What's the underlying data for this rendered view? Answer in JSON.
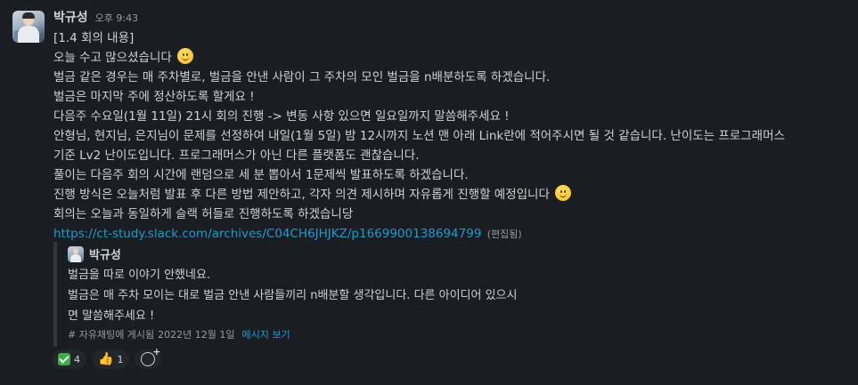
{
  "message": {
    "author": "박규성",
    "time": "오후 9:43",
    "lines": {
      "l1": "[1.4 회의 내용]",
      "l2": "오늘 수고 많으셨습니다",
      "l3": "벌금 같은 경우는 매 주차별로, 벌금을 안낸 사람이 그 주차의 모인 벌금을 n배분하도록 하겠습니다.",
      "l4": "벌금은 마지막 주에 정산하도록 할게요 !",
      "l5": "다음주 수요일(1월 11일) 21시 회의 진행 -> 변동 사항 있으면 일요일까지 말씀해주세요 !",
      "l6": "안형님, 현지님, 은지님이 문제를 선정하여 내일(1월 5일) 밤 12시까지 노션 맨 아래 Link란에 적어주시면 될 것 같습니다. 난이도는 프로그래머스",
      "l7": "기준 Lv2 난이도입니다. 프로그래머스가 아닌 다른 플랫폼도 괜찮습니다.",
      "l8": "풀이는 다음주 회의 시간에 랜덤으로 세 분 뽑아서 1문제씩 발표하도록 하겠습니다.",
      "l9": "진행 방식은 오늘처럼 발표 후 다른 방법 제안하고, 각자 의견 제시하며 자유롭게 진행할 예정입니다",
      "l10": "회의는 오늘과 동일하게 슬랙 허들로 진행하도록 하겠습니당"
    },
    "link": "https://ct-study.slack.com/archives/C04CH6JHJKZ/p1669900138694799",
    "edited": "(편집됨)",
    "emoji": "slightly-smiling-face"
  },
  "quote": {
    "author": "박규성",
    "lines": {
      "q1": "벌금을 따로 이야기 안했네요.",
      "q2": "벌금은 매 주차 모이는 대로 벌금 안낸 사람들끼리 n배분할 생각입니다. 다른 아이디어 있으시",
      "q3": "면 말씀해주세요 !"
    },
    "channel": "# 자유채팅에 게시됨",
    "date": "2022년 12월 1일",
    "view_label": "메시지 보기"
  },
  "reactions": [
    {
      "icon": "white-check-mark",
      "count": "4"
    },
    {
      "icon": "thumbs-up",
      "count": "1"
    }
  ],
  "colors": {
    "background": "#1a1d21",
    "text": "#d1d2d3",
    "link": "#1d9bd1",
    "muted": "#9a9b9e"
  }
}
